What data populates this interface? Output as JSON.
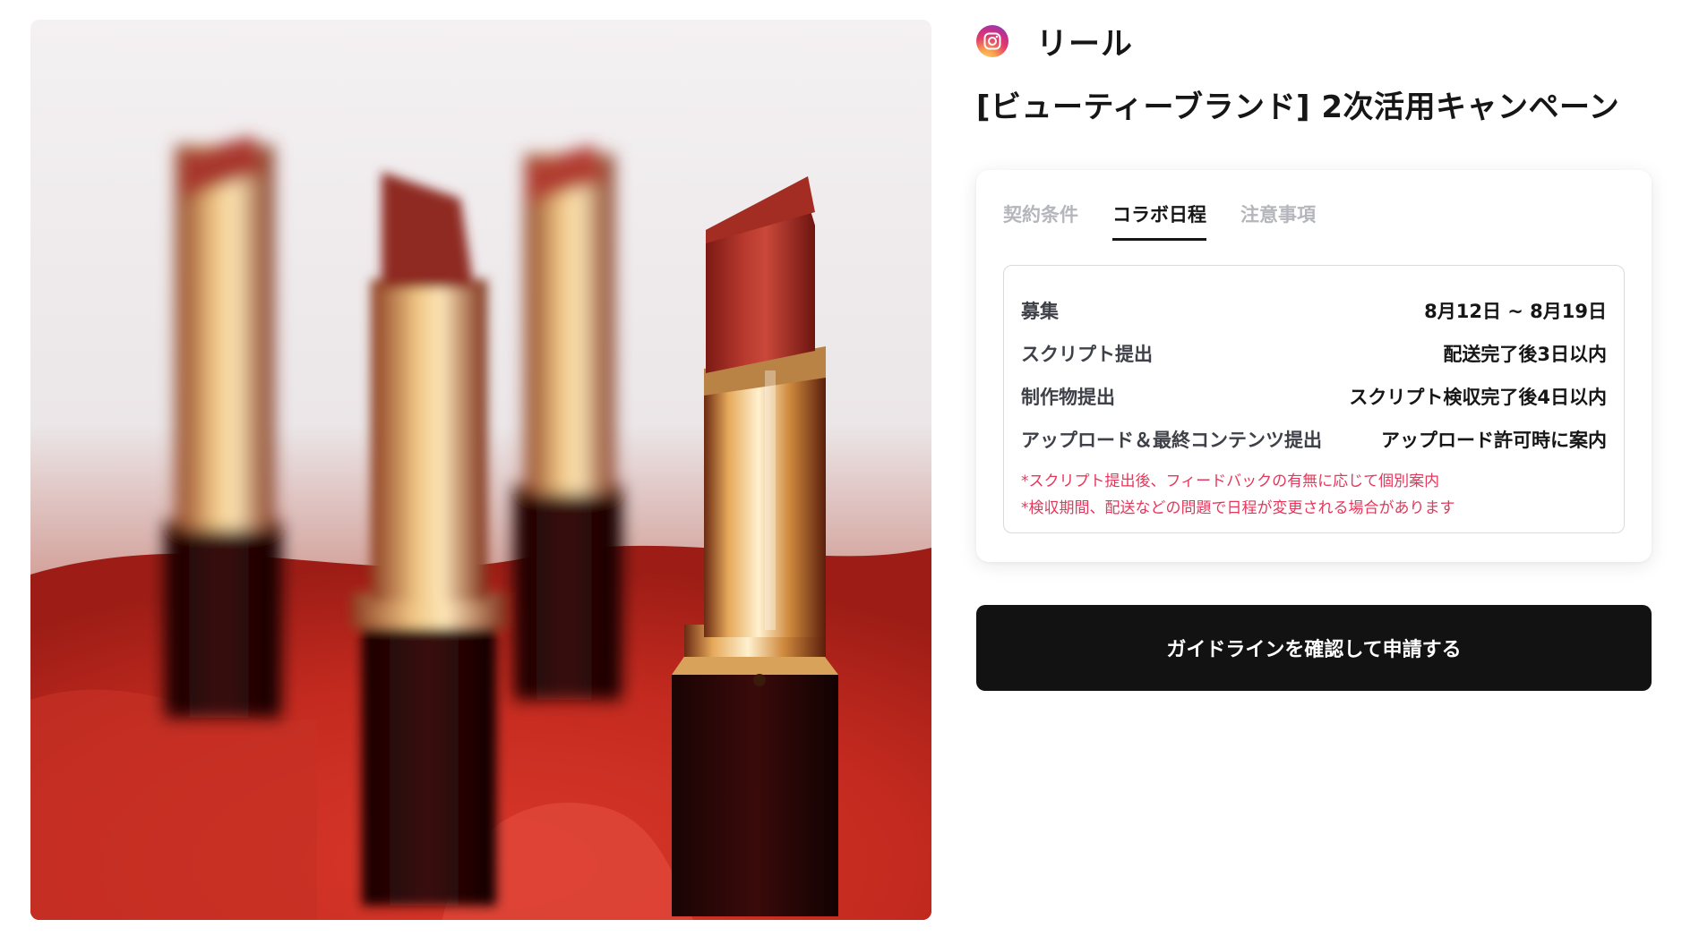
{
  "header": {
    "platform_icon": "instagram-icon",
    "platform_label": "リール"
  },
  "campaign": {
    "title": "[ビューティーブランド] 2次活用キャンペーン"
  },
  "tabs": [
    {
      "label": "契約条件",
      "active": false
    },
    {
      "label": "コラボ日程",
      "active": true
    },
    {
      "label": "注意事項",
      "active": false
    }
  ],
  "schedule": {
    "rows": [
      {
        "label": "募集",
        "value": "8月12日 ~ 8月19日"
      },
      {
        "label": "スクリプト提出",
        "value": "配送完了後3日以内"
      },
      {
        "label": "制作物提出",
        "value": "スクリプト検収完了後4日以内"
      },
      {
        "label": "アップロード＆最終コンテンツ提出",
        "value": "アップロード許可時に案内"
      }
    ],
    "notes": [
      "*スクリプト提出後、フィードバックの有無に応じて個別案内",
      "*検収期間、配送などの問題で日程が変更される場合があります"
    ]
  },
  "cta": {
    "label": "ガイドラインを確認して申請する"
  },
  "colors": {
    "accent_dark": "#121212",
    "note_red": "#e5375b",
    "tab_inactive": "#b4b6bc"
  }
}
